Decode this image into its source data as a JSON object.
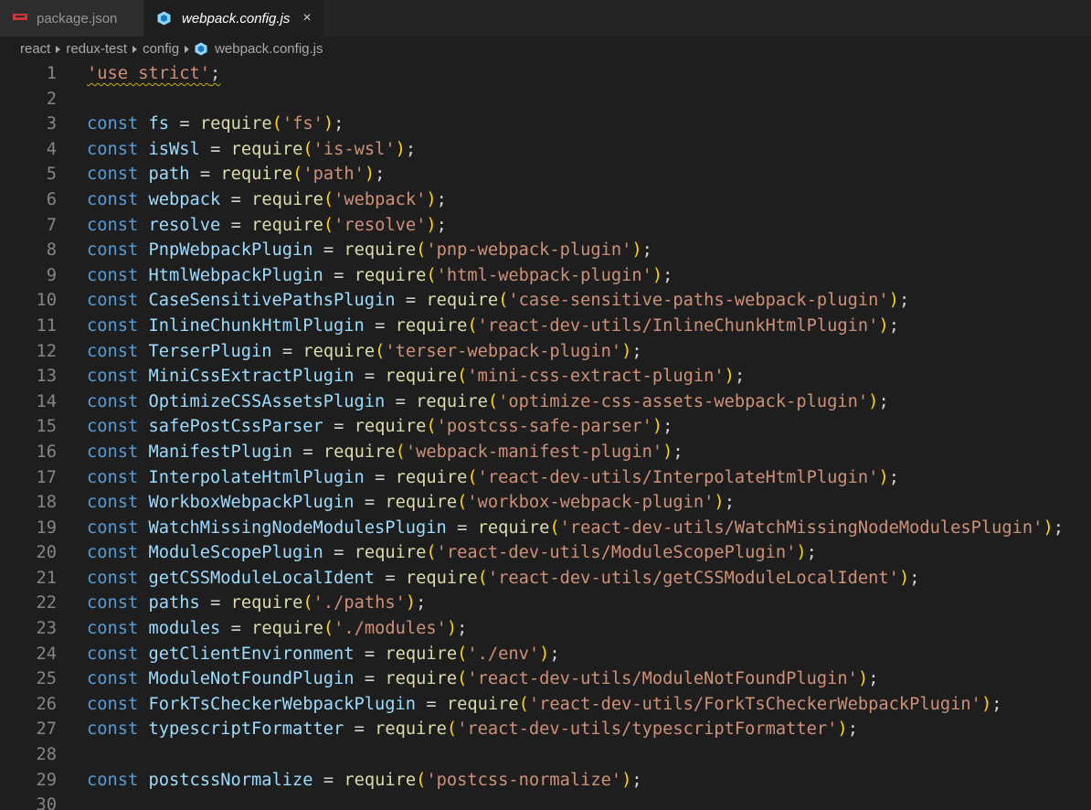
{
  "tabs": [
    {
      "label": "package.json",
      "icon": "npm-icon",
      "active": false
    },
    {
      "label": "webpack.config.js",
      "icon": "webpack-cube-icon",
      "active": true,
      "close": "×"
    }
  ],
  "breadcrumb": [
    "react",
    "redux-test",
    "config",
    "webpack.config.js"
  ],
  "colors": {
    "background": "#1e1e1e",
    "keyword": "#569cd6",
    "variable": "#9cdcfe",
    "function": "#dcdcaa",
    "string": "#ce9178",
    "bracket": "#ffd700",
    "line_number": "#858585"
  },
  "code": {
    "directive_line": {
      "number": "1",
      "text": "'use strict'",
      "semicolon": ";"
    },
    "blank_lines": [
      "2",
      "28",
      "30"
    ],
    "keyword": "const",
    "assign": "=",
    "call": "require",
    "open": "(",
    "close": ")",
    "semicolon": ";",
    "requires": [
      {
        "n": "3",
        "name": "fs",
        "module": "'fs'"
      },
      {
        "n": "4",
        "name": "isWsl",
        "module": "'is-wsl'"
      },
      {
        "n": "5",
        "name": "path",
        "module": "'path'"
      },
      {
        "n": "6",
        "name": "webpack",
        "module": "'webpack'"
      },
      {
        "n": "7",
        "name": "resolve",
        "module": "'resolve'"
      },
      {
        "n": "8",
        "name": "PnpWebpackPlugin",
        "module": "'pnp-webpack-plugin'"
      },
      {
        "n": "9",
        "name": "HtmlWebpackPlugin",
        "module": "'html-webpack-plugin'"
      },
      {
        "n": "10",
        "name": "CaseSensitivePathsPlugin",
        "module": "'case-sensitive-paths-webpack-plugin'"
      },
      {
        "n": "11",
        "name": "InlineChunkHtmlPlugin",
        "module": "'react-dev-utils/InlineChunkHtmlPlugin'"
      },
      {
        "n": "12",
        "name": "TerserPlugin",
        "module": "'terser-webpack-plugin'"
      },
      {
        "n": "13",
        "name": "MiniCssExtractPlugin",
        "module": "'mini-css-extract-plugin'"
      },
      {
        "n": "14",
        "name": "OptimizeCSSAssetsPlugin",
        "module": "'optimize-css-assets-webpack-plugin'"
      },
      {
        "n": "15",
        "name": "safePostCssParser",
        "module": "'postcss-safe-parser'"
      },
      {
        "n": "16",
        "name": "ManifestPlugin",
        "module": "'webpack-manifest-plugin'"
      },
      {
        "n": "17",
        "name": "InterpolateHtmlPlugin",
        "module": "'react-dev-utils/InterpolateHtmlPlugin'"
      },
      {
        "n": "18",
        "name": "WorkboxWebpackPlugin",
        "module": "'workbox-webpack-plugin'"
      },
      {
        "n": "19",
        "name": "WatchMissingNodeModulesPlugin",
        "module": "'react-dev-utils/WatchMissingNodeModulesPlugin'"
      },
      {
        "n": "20",
        "name": "ModuleScopePlugin",
        "module": "'react-dev-utils/ModuleScopePlugin'"
      },
      {
        "n": "21",
        "name": "getCSSModuleLocalIdent",
        "module": "'react-dev-utils/getCSSModuleLocalIdent'"
      },
      {
        "n": "22",
        "name": "paths",
        "module": "'./paths'"
      },
      {
        "n": "23",
        "name": "modules",
        "module": "'./modules'"
      },
      {
        "n": "24",
        "name": "getClientEnvironment",
        "module": "'./env'"
      },
      {
        "n": "25",
        "name": "ModuleNotFoundPlugin",
        "module": "'react-dev-utils/ModuleNotFoundPlugin'"
      },
      {
        "n": "26",
        "name": "ForkTsCheckerWebpackPlugin",
        "module": "'react-dev-utils/ForkTsCheckerWebpackPlugin'"
      },
      {
        "n": "27",
        "name": "typescriptFormatter",
        "module": "'react-dev-utils/typescriptFormatter'"
      },
      {
        "n": "29",
        "name": "postcssNormalize",
        "module": "'postcss-normalize'"
      }
    ]
  }
}
